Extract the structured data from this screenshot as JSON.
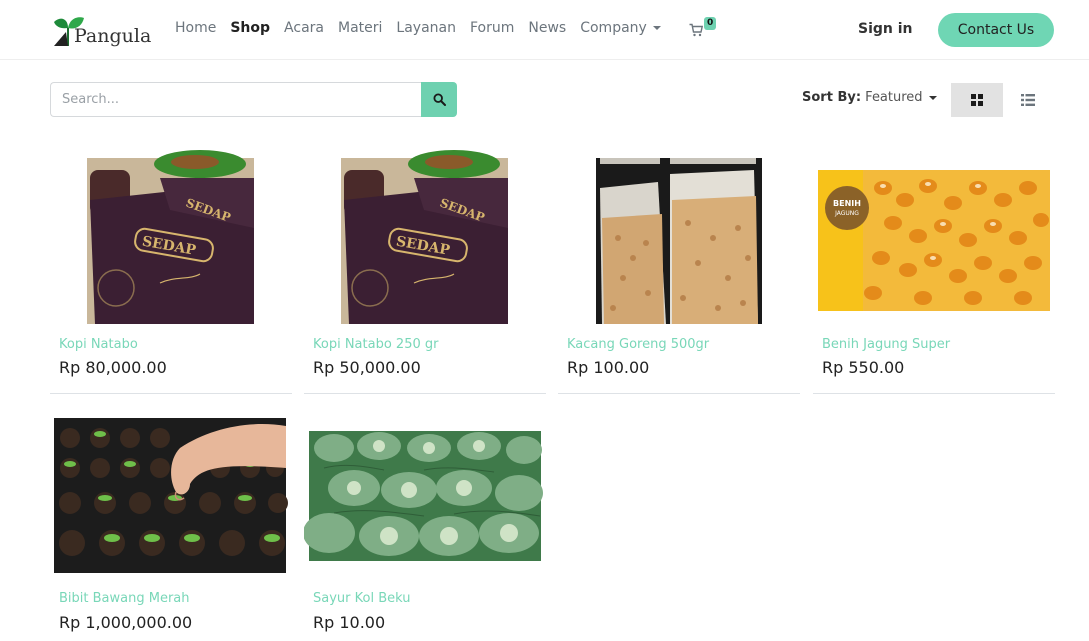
{
  "brand": {
    "name": "Pangula"
  },
  "nav": {
    "items": [
      {
        "label": "Home",
        "active": false
      },
      {
        "label": "Shop",
        "active": true
      },
      {
        "label": "Acara",
        "active": false
      },
      {
        "label": "Materi",
        "active": false
      },
      {
        "label": "Layanan",
        "active": false
      },
      {
        "label": "Forum",
        "active": false
      },
      {
        "label": "News",
        "active": false
      },
      {
        "label": "Company",
        "active": false,
        "dropdown": true
      }
    ],
    "cart_count": "0",
    "cart_icon": "shopping-cart-icon",
    "signin_label": "Sign in",
    "contact_label": "Contact Us"
  },
  "toolbar": {
    "search_placeholder": "Search...",
    "search_value": "",
    "search_icon": "search-icon",
    "sort_label": "Sort By:",
    "sort_value": "Featured",
    "view_modes": [
      {
        "icon": "grid-view-icon",
        "active": true
      },
      {
        "icon": "list-view-icon",
        "active": false
      }
    ]
  },
  "products": [
    {
      "name": "Kopi Natabo",
      "price": "Rp 80,000.00",
      "image": "coffee-bag"
    },
    {
      "name": "Kopi Natabo 250 gr",
      "price": "Rp 50,000.00",
      "image": "coffee-bag"
    },
    {
      "name": "Kacang Goreng 500gr",
      "price": "Rp 100.00",
      "image": "peanut-bags"
    },
    {
      "name": "Benih Jagung Super",
      "price": "Rp 550.00",
      "image": "corn-seeds",
      "badge": [
        "BENIH",
        "JAGUNG"
      ]
    },
    {
      "name": "Bibit Bawang Merah",
      "price": "Rp 1,000,000.00",
      "image": "seedling-tray"
    },
    {
      "name": "Sayur Kol Beku",
      "price": "Rp 10.00",
      "image": "cabbage-field"
    }
  ],
  "colors": {
    "accent": "#6ed1b0",
    "product_name": "#79d7b8",
    "text": "#222222",
    "muted": "#6c757d"
  }
}
